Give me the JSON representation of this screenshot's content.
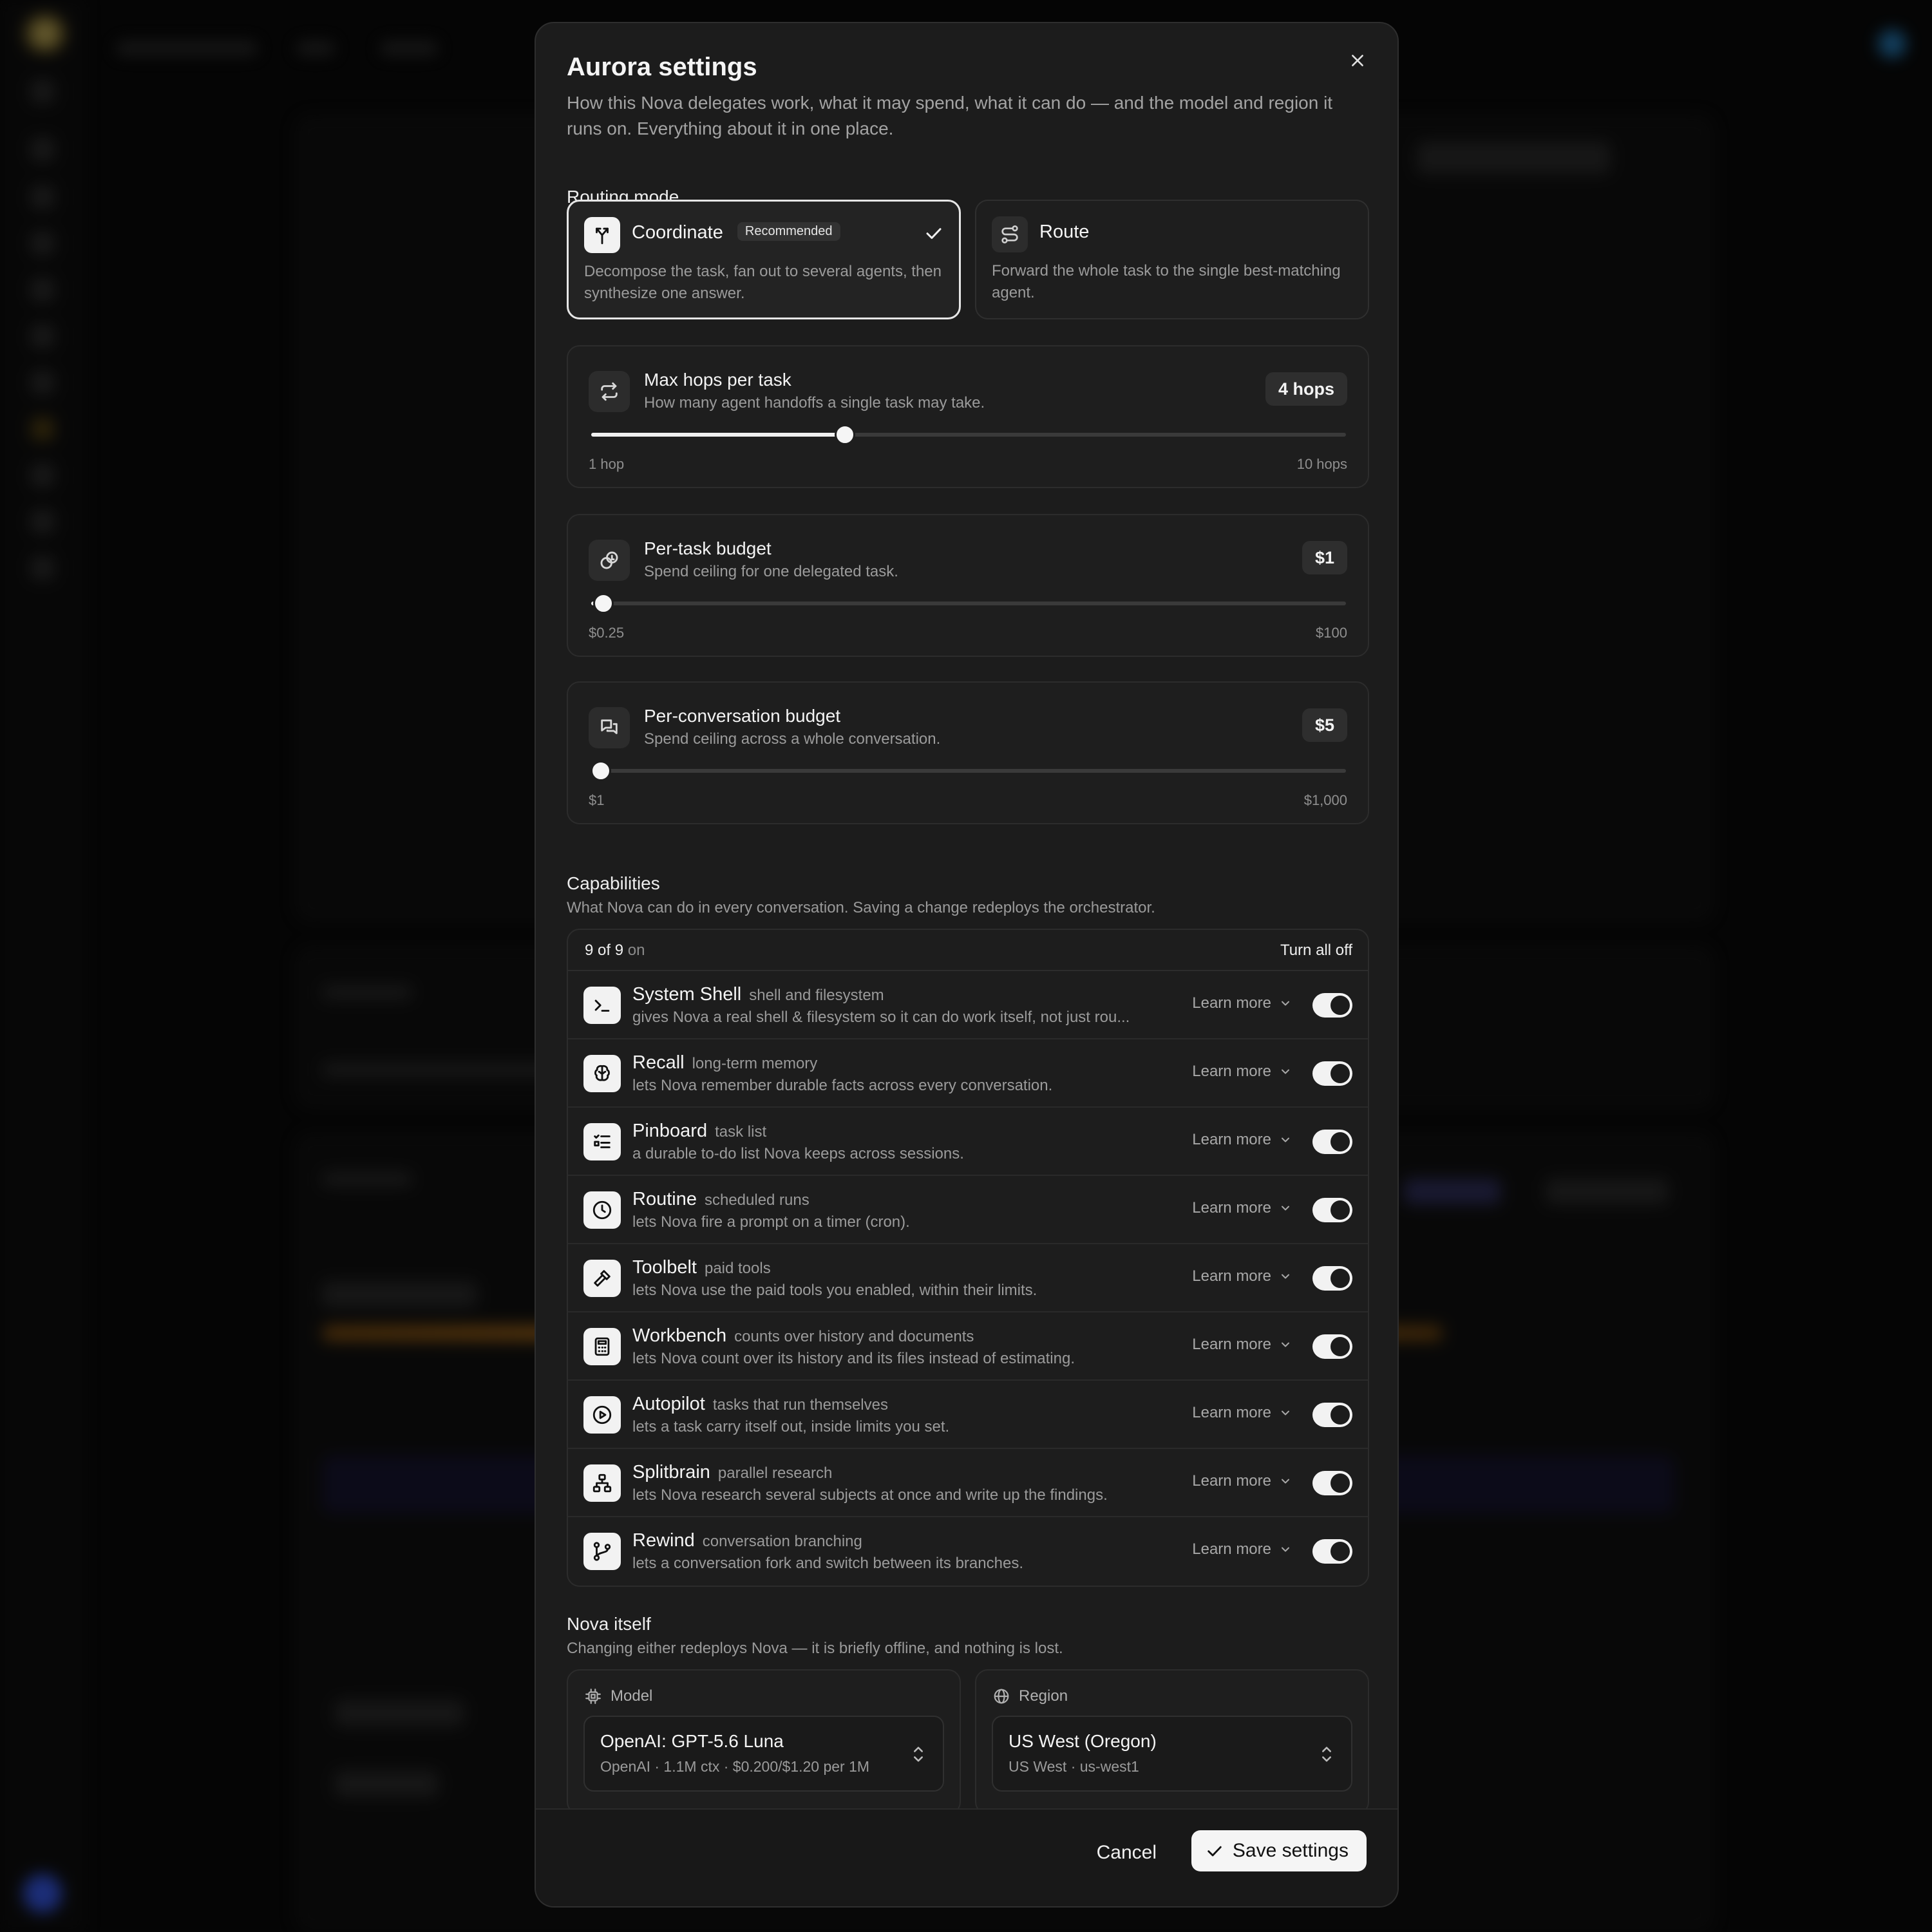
{
  "modal": {
    "title": "Aurora settings",
    "subtitle": "How this Nova delegates work, what it may spend, what it can do — and the model and region it runs on. Everything about it in one place."
  },
  "routing": {
    "label": "Routing mode",
    "options": [
      {
        "name": "Coordinate",
        "badge": "Recommended",
        "description": "Decompose the task, fan out to several agents, then synthesize one answer.",
        "selected": true,
        "icon": "split-arrows-icon"
      },
      {
        "name": "Route",
        "description": "Forward the whole task to the single best-matching agent.",
        "selected": false,
        "icon": "route-icon"
      }
    ]
  },
  "sliders": {
    "hops": {
      "title": "Max hops per task",
      "description": "How many agent handoffs a single task may take.",
      "value_label": "4  hops",
      "min_label": "1 hop",
      "max_label": "10 hops",
      "fraction": 0.336,
      "icon": "repeat-arrows-icon"
    },
    "task_budget": {
      "title": "Per-task budget",
      "description": "Spend ceiling for one delegated task.",
      "value_label": "$1",
      "min_label": "$0.25",
      "max_label": "$100",
      "fraction": 0.016,
      "icon": "coins-icon"
    },
    "conversation_budget": {
      "title": "Per-conversation budget",
      "description": "Spend ceiling across a whole conversation.",
      "value_label": "$5",
      "min_label": "$1",
      "max_label": "$1,000",
      "fraction": 0.013,
      "icon": "chat-bubbles-icon"
    }
  },
  "capabilities": {
    "label": "Capabilities",
    "description": "What Nova can do in every conversation. Saving a change redeploys the orchestrator.",
    "count": "9 of 9",
    "count_suffix": "on",
    "turn_all_off": "Turn all off",
    "learn_more": "Learn more",
    "items": [
      {
        "name": "System Shell",
        "tag": "shell and filesystem",
        "description": "gives Nova a real shell & filesystem so it can do work itself, not just rou...",
        "enabled": true,
        "icon": "terminal-icon"
      },
      {
        "name": "Recall",
        "tag": "long-term memory",
        "description": "lets Nova remember durable facts across every conversation.",
        "enabled": true,
        "icon": "brain-icon"
      },
      {
        "name": "Pinboard",
        "tag": "task list",
        "description": "a durable to-do list Nova keeps across sessions.",
        "enabled": true,
        "icon": "checklist-icon"
      },
      {
        "name": "Routine",
        "tag": "scheduled runs",
        "description": "lets Nova fire a prompt on a timer (cron).",
        "enabled": true,
        "icon": "clock-icon"
      },
      {
        "name": "Toolbelt",
        "tag": "paid tools",
        "description": "lets Nova use the paid tools you enabled, within their limits.",
        "enabled": true,
        "icon": "hammer-icon"
      },
      {
        "name": "Workbench",
        "tag": "counts over history and documents",
        "description": "lets Nova count over its history and its files instead of estimating.",
        "enabled": true,
        "icon": "calculator-icon"
      },
      {
        "name": "Autopilot",
        "tag": "tasks that run themselves",
        "description": "lets a task carry itself out, inside limits you set.",
        "enabled": true,
        "icon": "play-circle-icon"
      },
      {
        "name": "Splitbrain",
        "tag": "parallel research",
        "description": "lets Nova research several subjects at once and write up the findings.",
        "enabled": true,
        "icon": "network-icon"
      },
      {
        "name": "Rewind",
        "tag": "conversation branching",
        "description": "lets a conversation fork and switch between its branches.",
        "enabled": true,
        "icon": "git-branch-icon"
      }
    ]
  },
  "nova": {
    "label": "Nova itself",
    "description": "Changing either redeploys Nova — it is briefly offline, and nothing is lost.",
    "model": {
      "label": "Model",
      "value": "OpenAI: GPT-5.6 Luna",
      "sub": "OpenAI  ·  1.1M ctx  ·  $0.200/$1.20 per 1M"
    },
    "region": {
      "label": "Region",
      "value": "US West (Oregon)",
      "sub": "US West · us-west1"
    }
  },
  "footer": {
    "cancel": "Cancel",
    "save": "Save settings"
  },
  "colors": {
    "accent": "#f5f5f5",
    "surface": "#1c1c1c",
    "border": "#2c2c2c",
    "muted_text": "#9b9b9b"
  }
}
